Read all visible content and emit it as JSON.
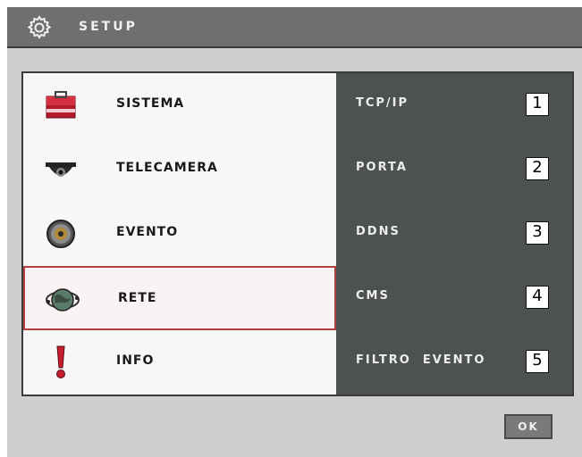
{
  "header": {
    "title": "SETUP",
    "icon": "gear-icon"
  },
  "menu": {
    "items": [
      {
        "label": "SISTEMA",
        "icon": "toolbox-icon"
      },
      {
        "label": "TELECAMERA",
        "icon": "dome-camera-icon"
      },
      {
        "label": "EVENTO",
        "icon": "event-sensor-icon"
      },
      {
        "label": "RETE",
        "icon": "network-globe-icon",
        "selected": true
      },
      {
        "label": "INFO",
        "icon": "exclamation-icon"
      }
    ]
  },
  "submenu": {
    "items": [
      {
        "label": "TCP/IP",
        "number": "1"
      },
      {
        "label": "PORTA",
        "number": "2"
      },
      {
        "label": "DDNS",
        "number": "3"
      },
      {
        "label": "CMS",
        "number": "4"
      },
      {
        "label": "FILTRO  EVENTO",
        "number": "5"
      }
    ]
  },
  "footer": {
    "ok_label": "OK"
  },
  "colors": {
    "title_bar": "#6f6f6f",
    "screen_bg": "#cfcfcf",
    "submenu_bg": "#4d524e",
    "selection_border": "#b04040"
  }
}
